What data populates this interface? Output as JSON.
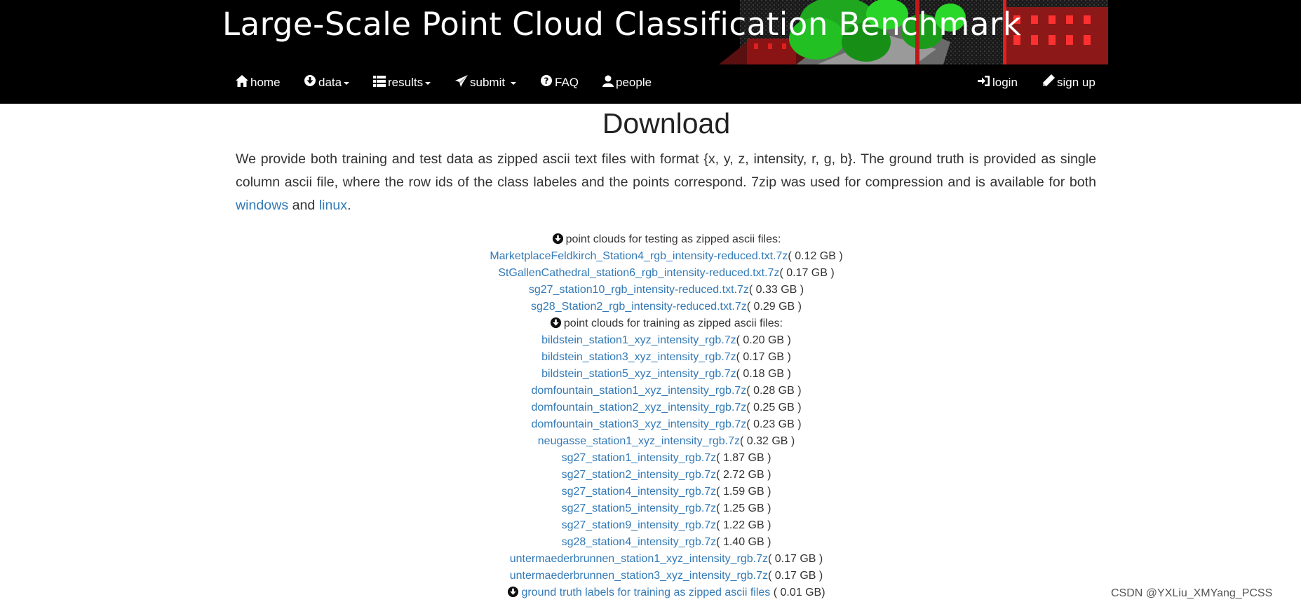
{
  "header": {
    "banner_title": "Large-Scale Point Cloud Classification Benchmark",
    "nav_left": [
      {
        "label": "home",
        "icon": "home-icon",
        "dropdown": false
      },
      {
        "label": "data",
        "icon": "download-circle-icon",
        "dropdown": true
      },
      {
        "label": "results",
        "icon": "list-icon",
        "dropdown": true
      },
      {
        "label": "submit ",
        "icon": "send-icon",
        "dropdown": true
      },
      {
        "label": "FAQ",
        "icon": "question-circle-icon",
        "dropdown": false
      },
      {
        "label": "people",
        "icon": "user-icon",
        "dropdown": false
      }
    ],
    "nav_right": [
      {
        "label": "login",
        "icon": "login-icon"
      },
      {
        "label": "sign up",
        "icon": "pencil-icon"
      }
    ]
  },
  "main": {
    "title": "Download",
    "intro_text_1": "We provide both training and test data as zipped ascii text files with format {x, y, z, intensity, r, g, b}. The ground truth is provided as single column ascii file, where the row ids of the class labeles and the points correspond. 7zip was used for compression and is available for both ",
    "intro_link_windows": "windows",
    "intro_text_2": " and ",
    "intro_link_linux": "linux",
    "intro_text_3": ".",
    "testing_heading": "point clouds for testing as zipped ascii files:",
    "testing_files": [
      {
        "name": "MarketplaceFeldkirch_Station4_rgb_intensity-reduced.txt.7z",
        "size": "( 0.12 GB )"
      },
      {
        "name": "StGallenCathedral_station6_rgb_intensity-reduced.txt.7z",
        "size": "( 0.17 GB )"
      },
      {
        "name": "sg27_station10_rgb_intensity-reduced.txt.7z",
        "size": "( 0.33 GB )"
      },
      {
        "name": "sg28_Station2_rgb_intensity-reduced.txt.7z",
        "size": "( 0.29 GB )"
      }
    ],
    "training_heading": "point clouds for training as zipped ascii files:",
    "training_files": [
      {
        "name": "bildstein_station1_xyz_intensity_rgb.7z",
        "size": "( 0.20 GB )"
      },
      {
        "name": "bildstein_station3_xyz_intensity_rgb.7z",
        "size": "( 0.17 GB )"
      },
      {
        "name": "bildstein_station5_xyz_intensity_rgb.7z",
        "size": "( 0.18 GB )"
      },
      {
        "name": "domfountain_station1_xyz_intensity_rgb.7z",
        "size": "( 0.28 GB )"
      },
      {
        "name": "domfountain_station2_xyz_intensity_rgb.7z",
        "size": "( 0.25 GB )"
      },
      {
        "name": "domfountain_station3_xyz_intensity_rgb.7z",
        "size": "( 0.23 GB )"
      },
      {
        "name": "neugasse_station1_xyz_intensity_rgb.7z",
        "size": "( 0.32 GB )"
      },
      {
        "name": "sg27_station1_intensity_rgb.7z",
        "size": "( 1.87 GB )"
      },
      {
        "name": "sg27_station2_intensity_rgb.7z",
        "size": "( 2.72 GB )"
      },
      {
        "name": "sg27_station4_intensity_rgb.7z",
        "size": "( 1.59 GB )"
      },
      {
        "name": "sg27_station5_intensity_rgb.7z",
        "size": "( 1.25 GB )"
      },
      {
        "name": "sg27_station9_intensity_rgb.7z",
        "size": "( 1.22 GB )"
      },
      {
        "name": "sg28_station4_intensity_rgb.7z",
        "size": "( 1.40 GB )"
      },
      {
        "name": "untermaederbrunnen_station1_xyz_intensity_rgb.7z",
        "size": "( 0.17 GB )"
      },
      {
        "name": "untermaederbrunnen_station3_xyz_intensity_rgb.7z",
        "size": "( 0.17 GB )"
      }
    ],
    "ground_truth": {
      "name": "ground truth labels for training as zipped ascii files",
      "size": "( 0.01 GB)"
    }
  },
  "watermark": "CSDN @YXLiu_XMYang_PCSS",
  "colors": {
    "link": "#337ab7",
    "header_bg": "#000000",
    "text": "#333333"
  }
}
